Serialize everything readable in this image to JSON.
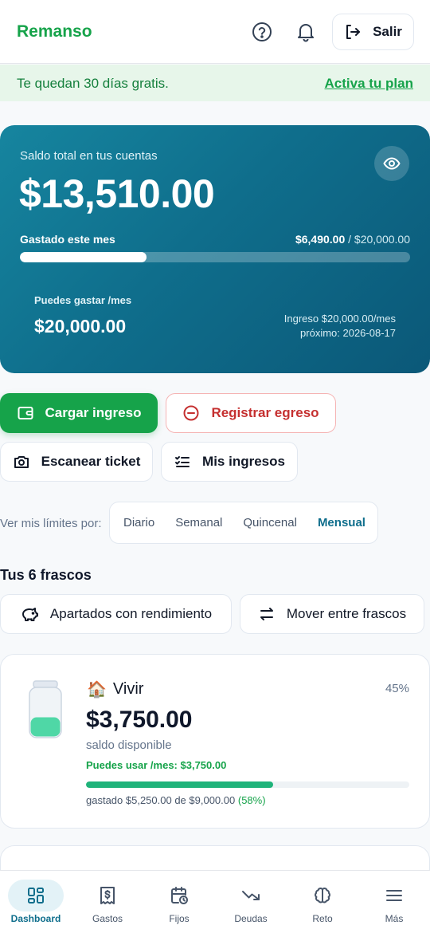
{
  "header": {
    "brand": "Remanso",
    "logout_label": "Salir"
  },
  "trial": {
    "message": "Te quedan 30 días gratis.",
    "link": "Activa tu plan"
  },
  "balance": {
    "label": "Saldo total en tus cuentas",
    "amount": "$13,510.00",
    "spent_label": "Gastado este mes",
    "spent_amount": "$6,490.00",
    "spent_total": " / $20,000.00",
    "spent_fraction": 0.3245,
    "can_spend_label": "Puedes gastar /mes",
    "can_spend_amount": "$20,000.00",
    "income_line": "Ingreso $20,000.00/mes",
    "next_line": "próximo: 2026-08-17"
  },
  "actions": {
    "load_income": "Cargar ingreso",
    "register_expense": "Registrar egreso",
    "scan_ticket": "Escanear ticket",
    "my_income": "Mis ingresos"
  },
  "limits": {
    "label": "Ver mis límites por:",
    "options": [
      "Diario",
      "Semanal",
      "Quincenal",
      "Mensual"
    ],
    "selected": "Mensual"
  },
  "jars": {
    "title": "Tus 6 frascos",
    "savings_button": "Apartados con rendimiento",
    "move_button": "Mover entre frascos",
    "items": [
      {
        "emoji": "🏠",
        "name": "Vivir",
        "percent": "45%",
        "amount": "$3,750.00",
        "sub": "saldo disponible",
        "can_use": "Puedes usar /mes: $3,750.00",
        "spent_text": "gastado $5,250.00 de $9,000.00",
        "spent_pct": "(58%)",
        "progress": 0.58,
        "fill_level": 0.4
      }
    ]
  },
  "nav": {
    "items": [
      "Dashboard",
      "Gastos",
      "Fijos",
      "Deudas",
      "Reto",
      "Más"
    ],
    "active": "Dashboard"
  },
  "colors": {
    "brand": "#16a34a",
    "primary": "#0f6e8c",
    "danger": "#c53030"
  }
}
